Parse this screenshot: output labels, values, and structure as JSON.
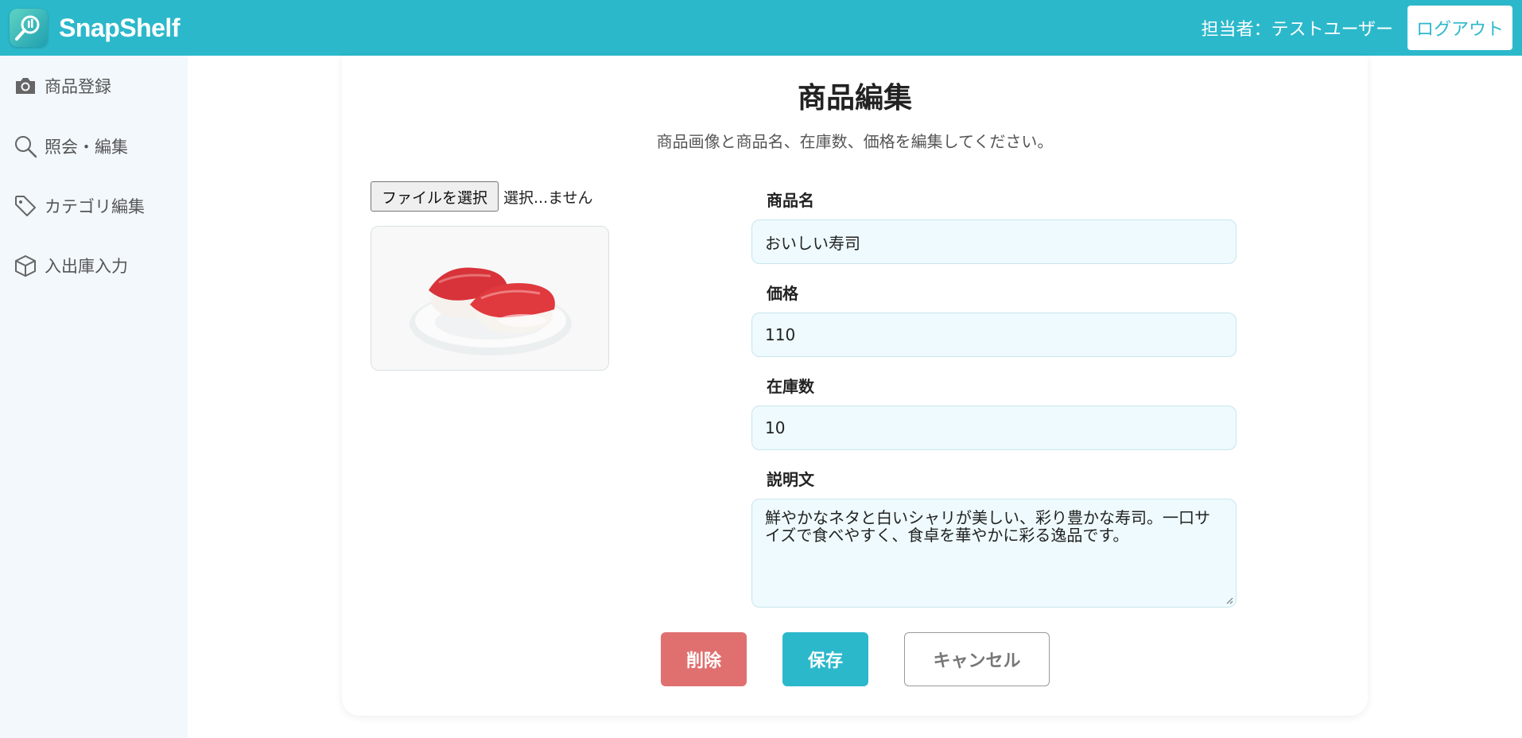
{
  "app": {
    "name": "SnapShelf",
    "accent_color": "#2cb8cb"
  },
  "header": {
    "user_label": "担当者：テストユーザー",
    "logout_label": "ログアウト"
  },
  "sidebar": {
    "items": [
      {
        "label": "商品登録",
        "icon": "camera-icon"
      },
      {
        "label": "照会・編集",
        "icon": "search-icon"
      },
      {
        "label": "カテゴリ編集",
        "icon": "tag-icon"
      },
      {
        "label": "入出庫入力",
        "icon": "box-icon"
      }
    ]
  },
  "main": {
    "title": "商品編集",
    "description": "商品画像と商品名、在庫数、価格を編集してください。",
    "file_input": {
      "button_label": "ファイルを選択",
      "status": "選択...ません"
    },
    "preview_image": "sushi-image",
    "fields": {
      "name": {
        "label": "商品名",
        "value": "おいしい寿司"
      },
      "price": {
        "label": "価格",
        "value": "110"
      },
      "stock": {
        "label": "在庫数",
        "value": "10"
      },
      "description": {
        "label": "説明文",
        "value": "鮮やかなネタと白いシャリが美しい、彩り豊かな寿司。一口サイズで食べやすく、食卓を華やかに彩る逸品です。"
      }
    },
    "buttons": {
      "delete": "削除",
      "save": "保存",
      "cancel": "キャンセル"
    },
    "colors": {
      "delete": "#e07070",
      "save": "#2cb8cb"
    }
  }
}
